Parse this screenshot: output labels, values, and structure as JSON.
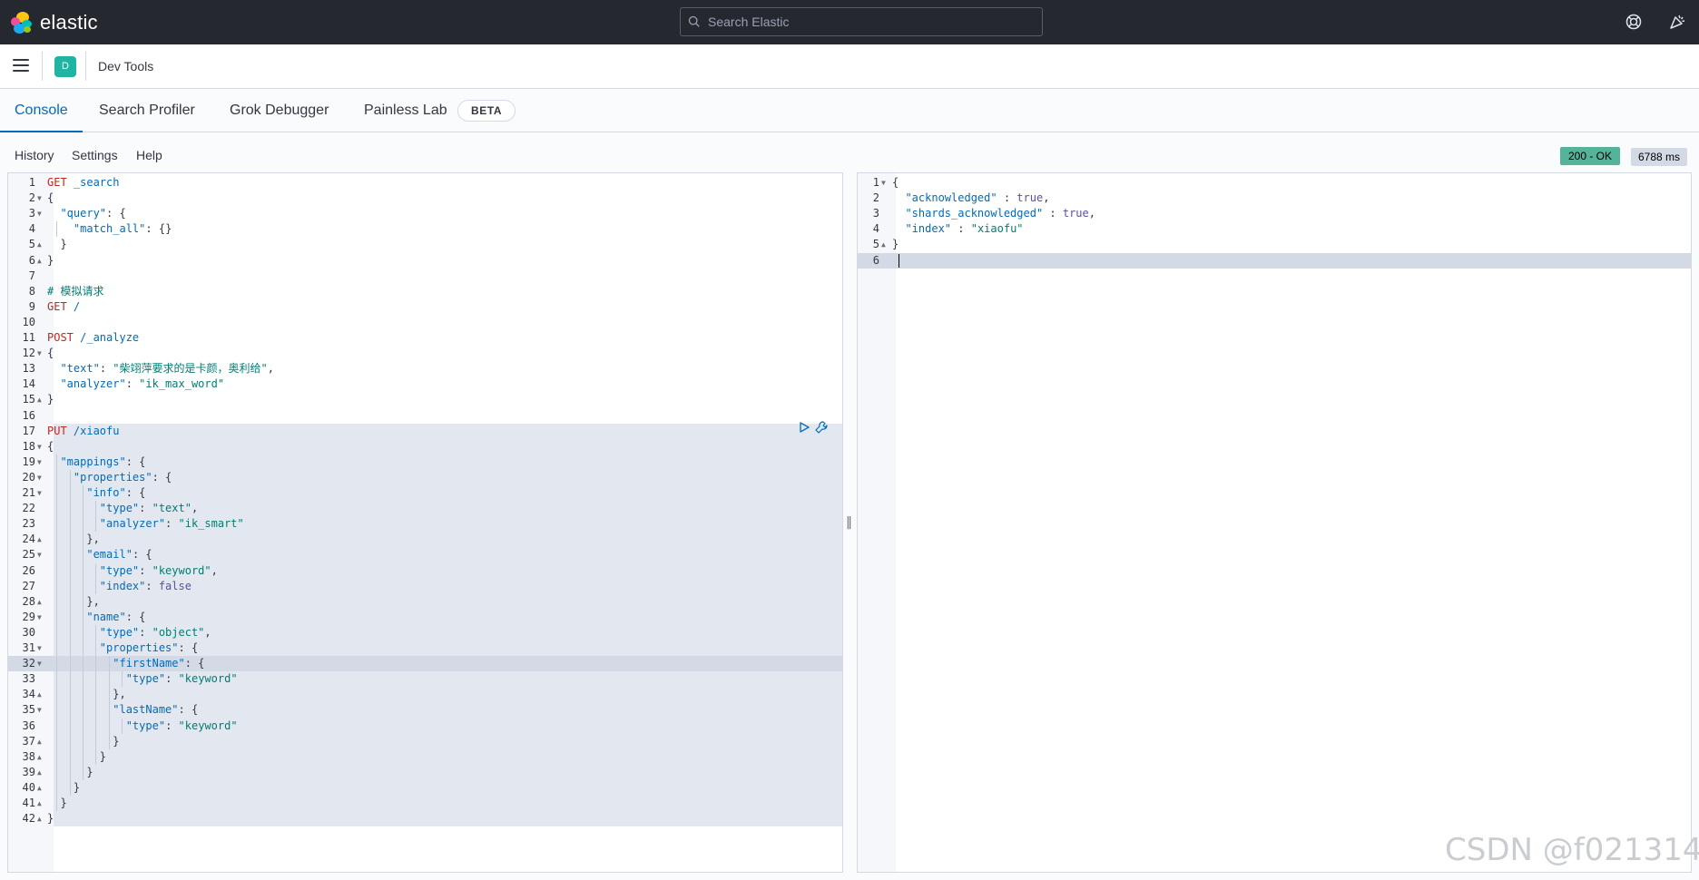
{
  "header": {
    "logo_text": "elastic",
    "search_placeholder": "Search Elastic",
    "help_icon": "help-lifebuoy-icon",
    "newsfeed_icon": "newsfeed-icon"
  },
  "breadcrumb": {
    "app_badge": "D",
    "title": "Dev Tools"
  },
  "tabs": [
    {
      "label": "Console",
      "active": true
    },
    {
      "label": "Search Profiler",
      "active": false
    },
    {
      "label": "Grok Debugger",
      "active": false
    },
    {
      "label": "Painless Lab",
      "active": false
    }
  ],
  "beta_badge": "BETA",
  "console_toolbar": {
    "history": "History",
    "settings": "Settings",
    "help": "Help"
  },
  "status": {
    "code": "200 - OK",
    "time": "6788 ms"
  },
  "request_editor": {
    "lines": [
      [
        [
          "method",
          "GET"
        ],
        [
          "url",
          " _search"
        ]
      ],
      [
        [
          "punc",
          "{"
        ]
      ],
      [
        [
          "punc",
          "  "
        ],
        [
          "key",
          "\"query\""
        ],
        [
          "punc",
          ": {"
        ]
      ],
      [
        [
          "punc",
          "    "
        ],
        [
          "key",
          "\"match_all\""
        ],
        [
          "punc",
          ": {}"
        ]
      ],
      [
        [
          "punc",
          "  }"
        ]
      ],
      [
        [
          "punc",
          "}"
        ]
      ],
      [],
      [
        [
          "comment",
          "# 模拟请求"
        ]
      ],
      [
        [
          "method",
          "GET"
        ],
        [
          "url",
          " /"
        ]
      ],
      [],
      [
        [
          "method",
          "POST"
        ],
        [
          "url",
          " /_analyze"
        ]
      ],
      [
        [
          "punc",
          "{"
        ]
      ],
      [
        [
          "punc",
          "  "
        ],
        [
          "key",
          "\"text\""
        ],
        [
          "punc",
          ": "
        ],
        [
          "str",
          "\"柴翊萍要求的是卡颜，奥利给\""
        ],
        [
          "punc",
          ","
        ]
      ],
      [
        [
          "punc",
          "  "
        ],
        [
          "key",
          "\"analyzer\""
        ],
        [
          "punc",
          ": "
        ],
        [
          "str",
          "\"ik_max_word\""
        ]
      ],
      [
        [
          "punc",
          "}"
        ]
      ],
      [],
      [
        [
          "method",
          "PUT"
        ],
        [
          "url",
          " /xiaofu"
        ]
      ],
      [
        [
          "punc",
          "{"
        ]
      ],
      [
        [
          "punc",
          "  "
        ],
        [
          "key",
          "\"mappings\""
        ],
        [
          "punc",
          ": {"
        ]
      ],
      [
        [
          "punc",
          "    "
        ],
        [
          "key",
          "\"properties\""
        ],
        [
          "punc",
          ": {"
        ]
      ],
      [
        [
          "punc",
          "      "
        ],
        [
          "key",
          "\"info\""
        ],
        [
          "punc",
          ": {"
        ]
      ],
      [
        [
          "punc",
          "        "
        ],
        [
          "key",
          "\"type\""
        ],
        [
          "punc",
          ": "
        ],
        [
          "str",
          "\"text\""
        ],
        [
          "punc",
          ","
        ]
      ],
      [
        [
          "punc",
          "        "
        ],
        [
          "key",
          "\"analyzer\""
        ],
        [
          "punc",
          ": "
        ],
        [
          "str",
          "\"ik_smart\""
        ]
      ],
      [
        [
          "punc",
          "      },"
        ]
      ],
      [
        [
          "punc",
          "      "
        ],
        [
          "key",
          "\"email\""
        ],
        [
          "punc",
          ": {"
        ]
      ],
      [
        [
          "punc",
          "        "
        ],
        [
          "key",
          "\"type\""
        ],
        [
          "punc",
          ": "
        ],
        [
          "str",
          "\"keyword\""
        ],
        [
          "punc",
          ","
        ]
      ],
      [
        [
          "punc",
          "        "
        ],
        [
          "key",
          "\"index\""
        ],
        [
          "punc",
          ": "
        ],
        [
          "bool",
          "false"
        ]
      ],
      [
        [
          "punc",
          "      },"
        ]
      ],
      [
        [
          "punc",
          "      "
        ],
        [
          "key",
          "\"name\""
        ],
        [
          "punc",
          ": {"
        ]
      ],
      [
        [
          "punc",
          "        "
        ],
        [
          "key",
          "\"type\""
        ],
        [
          "punc",
          ": "
        ],
        [
          "str",
          "\"object\""
        ],
        [
          "punc",
          ","
        ]
      ],
      [
        [
          "punc",
          "        "
        ],
        [
          "key",
          "\"properties\""
        ],
        [
          "punc",
          ": {"
        ]
      ],
      [
        [
          "punc",
          "          "
        ],
        [
          "key",
          "\"firstName\""
        ],
        [
          "punc",
          ": {"
        ]
      ],
      [
        [
          "punc",
          "            "
        ],
        [
          "key",
          "\"type\""
        ],
        [
          "punc",
          ": "
        ],
        [
          "str",
          "\"keyword\""
        ]
      ],
      [
        [
          "punc",
          "          },"
        ]
      ],
      [
        [
          "punc",
          "          "
        ],
        [
          "key",
          "\"lastName\""
        ],
        [
          "punc",
          ": {"
        ]
      ],
      [
        [
          "punc",
          "            "
        ],
        [
          "key",
          "\"type\""
        ],
        [
          "punc",
          ": "
        ],
        [
          "str",
          "\"keyword\""
        ]
      ],
      [
        [
          "punc",
          "          }"
        ]
      ],
      [
        [
          "punc",
          "        }"
        ]
      ],
      [
        [
          "punc",
          "      }"
        ]
      ],
      [
        [
          "punc",
          "    }"
        ]
      ],
      [
        [
          "punc",
          "  }"
        ]
      ],
      [
        [
          "punc",
          "}"
        ]
      ]
    ],
    "fold_down": [
      2,
      3,
      12,
      18,
      19,
      20,
      21,
      25,
      29,
      31,
      32,
      35
    ],
    "fold_up": [
      5,
      6,
      15,
      24,
      28,
      34,
      37,
      38,
      39,
      40,
      41,
      42
    ],
    "selected_block": [
      17,
      42
    ],
    "active_line": 32,
    "run_icon": "play-icon",
    "wrench_icon": "wrench-icon"
  },
  "response_editor": {
    "lines": [
      [
        [
          "punc",
          "{"
        ]
      ],
      [
        [
          "punc",
          "  "
        ],
        [
          "key",
          "\"acknowledged\""
        ],
        [
          "punc",
          " : "
        ],
        [
          "bool",
          "true"
        ],
        [
          "punc",
          ","
        ]
      ],
      [
        [
          "punc",
          "  "
        ],
        [
          "key",
          "\"shards_acknowledged\""
        ],
        [
          "punc",
          " : "
        ],
        [
          "bool",
          "true"
        ],
        [
          "punc",
          ","
        ]
      ],
      [
        [
          "punc",
          "  "
        ],
        [
          "key",
          "\"index\""
        ],
        [
          "punc",
          " : "
        ],
        [
          "str",
          "\"xiaofu\""
        ]
      ],
      [
        [
          "punc",
          "}"
        ]
      ],
      []
    ],
    "fold_down": [
      1
    ],
    "fold_up": [
      5
    ],
    "active_line": 6
  },
  "resizer_glyph": "‖",
  "watermark": "CSDN @f021314"
}
